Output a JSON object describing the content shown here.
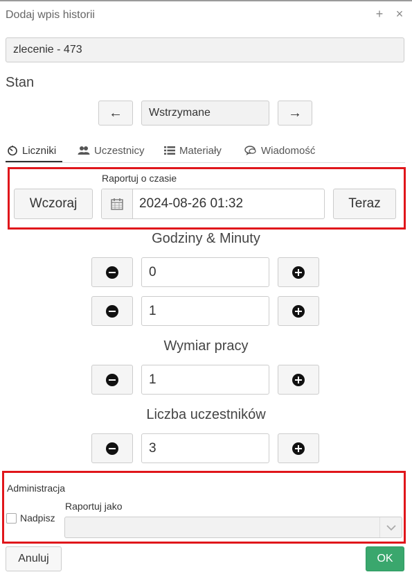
{
  "dialog": {
    "title": "Dodaj wpis historii",
    "add_icon": "+",
    "close_icon": "×"
  },
  "order_field": {
    "value": "zlecenie - 473"
  },
  "state": {
    "heading": "Stan",
    "prev_icon": "←",
    "next_icon": "→",
    "value": "Wstrzymane"
  },
  "tabs": [
    {
      "label": "Liczniki",
      "icon": "timer-icon",
      "active": true
    },
    {
      "label": "Uczestnicy",
      "icon": "users-icon"
    },
    {
      "label": "Materiały",
      "icon": "list-icon"
    },
    {
      "label": "Wiadomość",
      "icon": "chat-icon"
    }
  ],
  "report": {
    "label": "Raportuj o czasie",
    "yesterday_label": "Wczoraj",
    "datetime": "2024-08-26 01:32",
    "now_label": "Teraz"
  },
  "hours_minutes": {
    "heading": "Godziny & Minuty",
    "hours": "0",
    "minutes": "1"
  },
  "work_dimension": {
    "heading": "Wymiar pracy",
    "value": "1"
  },
  "participants": {
    "heading": "Liczba uczestników",
    "value": "3"
  },
  "admin": {
    "heading": "Administracja",
    "overwrite_label": "Nadpisz",
    "report_as_label": "Raportuj jako",
    "report_as_value": ""
  },
  "footer": {
    "cancel_label": "Anuluj",
    "ok_label": "OK"
  },
  "colors": {
    "highlight": "#e0161b",
    "ok": "#3aa76d"
  }
}
